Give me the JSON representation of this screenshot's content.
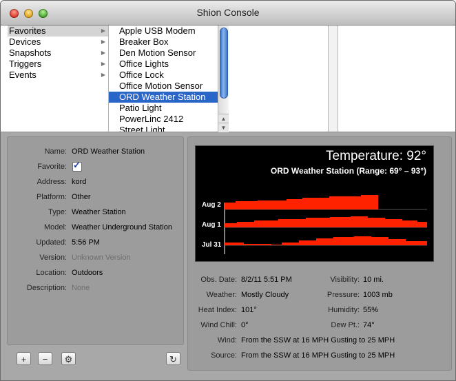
{
  "window": {
    "title": "Shion Console"
  },
  "columns": {
    "categories": [
      {
        "label": "Favorites",
        "selected": true
      },
      {
        "label": "Devices",
        "selected": false
      },
      {
        "label": "Snapshots",
        "selected": false
      },
      {
        "label": "Triggers",
        "selected": false
      },
      {
        "label": "Events",
        "selected": false
      }
    ],
    "items": [
      {
        "label": "Apple USB Modem",
        "selected": false
      },
      {
        "label": "Breaker Box",
        "selected": false
      },
      {
        "label": "Den Motion Sensor",
        "selected": false
      },
      {
        "label": "Office Lights",
        "selected": false
      },
      {
        "label": "Office Lock",
        "selected": false
      },
      {
        "label": "Office Motion Sensor",
        "selected": false
      },
      {
        "label": "ORD Weather Station",
        "selected": true
      },
      {
        "label": "Patio Light",
        "selected": false
      },
      {
        "label": "PowerLinc 2412",
        "selected": false
      },
      {
        "label": "Street Light",
        "selected": false
      }
    ]
  },
  "details": {
    "name": {
      "label": "Name:",
      "value": "ORD Weather Station"
    },
    "favorite": {
      "label": "Favorite:",
      "checked": true
    },
    "address": {
      "label": "Address:",
      "value": "kord"
    },
    "platform": {
      "label": "Platform:",
      "value": "Other"
    },
    "type": {
      "label": "Type:",
      "value": "Weather Station"
    },
    "model": {
      "label": "Model:",
      "value": "Weather Underground Station"
    },
    "updated": {
      "label": "Updated:",
      "value": "5:56 PM"
    },
    "version": {
      "label": "Version:",
      "value": "Unknown Version"
    },
    "location": {
      "label": "Location:",
      "value": "Outdoors"
    },
    "description": {
      "label": "Description:",
      "value": "None"
    }
  },
  "graph": {
    "title": "Temperature: 92°",
    "subtitle": "ORD Weather Station (Range: 69° – 93°)",
    "bar_color": "#ff2200",
    "rows": [
      {
        "label": "Aug 2"
      },
      {
        "label": "Aug 1"
      },
      {
        "label": "Jul 31"
      }
    ]
  },
  "observation": {
    "obs_date": {
      "label": "Obs. Date:",
      "value": "8/2/11 5:51 PM"
    },
    "weather": {
      "label": "Weather:",
      "value": "Mostly Cloudy"
    },
    "heat_index": {
      "label": "Heat Index:",
      "value": "101°"
    },
    "wind_chill": {
      "label": "Wind Chill:",
      "value": "0°"
    },
    "visibility": {
      "label": "Visibility:",
      "value": "10 mi."
    },
    "pressure": {
      "label": "Pressure:",
      "value": "1003 mb"
    },
    "humidity": {
      "label": "Humidity:",
      "value": "55%"
    },
    "dew_point": {
      "label": "Dew Pt.:",
      "value": "74°"
    },
    "wind": {
      "label": "Wind:",
      "value": "From the SSW at 16 MPH Gusting to 25 MPH"
    },
    "source": {
      "label": "Source:",
      "value": "From the SSW at 16 MPH Gusting to 25 MPH"
    }
  },
  "toolbar": {
    "add_label": "+",
    "remove_label": "−",
    "settings_icon": "gear-icon",
    "refresh_icon": "refresh-icon"
  }
}
